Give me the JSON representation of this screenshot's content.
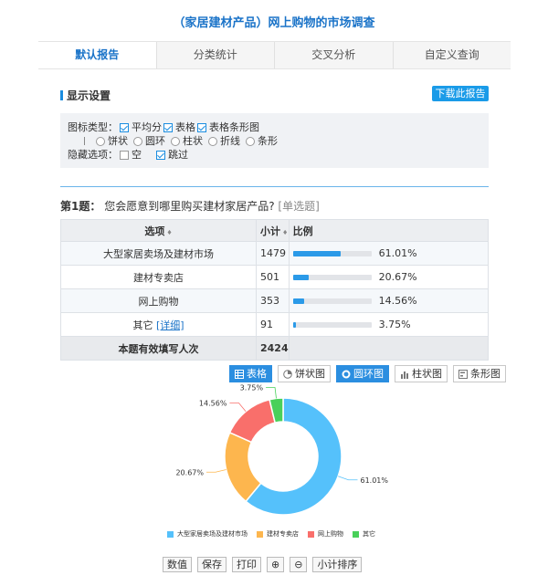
{
  "page_title": "（家居建材产品）网上购物的市场调查",
  "tabs": [
    {
      "label": "默认报告",
      "active": true
    },
    {
      "label": "分类统计",
      "active": false
    },
    {
      "label": "交叉分析",
      "active": false
    },
    {
      "label": "自定义查询",
      "active": false
    }
  ],
  "settings": {
    "title": "显示设置",
    "download_label": "下载此报告",
    "chart_type_label": "图标类型：",
    "chart_type_checks": [
      {
        "label": "平均分",
        "checked": true
      },
      {
        "label": "表格",
        "checked": true
      },
      {
        "label": "表格条形图",
        "checked": true
      }
    ],
    "chart_type_radios": [
      "饼状",
      "圆环",
      "柱状",
      "折线",
      "条形"
    ],
    "hide_label": "隐藏选项：",
    "hide_checks": [
      {
        "label": "空",
        "checked": false
      },
      {
        "label": "跳过",
        "checked": true
      }
    ]
  },
  "question": {
    "number": "第1题：",
    "text": "您会愿意到哪里购买建材家居产品?",
    "type": "[单选题]"
  },
  "table": {
    "headers": {
      "option": "选项",
      "count": "小计",
      "ratio": "比例"
    },
    "rows": [
      {
        "option": "大型家居卖场及建材市场",
        "count": "1479",
        "percent": "61.01%",
        "fraction": 0.6101,
        "link": ""
      },
      {
        "option": "建材专卖店",
        "count": "501",
        "percent": "20.67%",
        "fraction": 0.2067,
        "link": ""
      },
      {
        "option": "网上购物",
        "count": "353",
        "percent": "14.56%",
        "fraction": 0.1456,
        "link": ""
      },
      {
        "option": "其它",
        "count": "91",
        "percent": "3.75%",
        "fraction": 0.0375,
        "link": "[详细]"
      }
    ],
    "total_label": "本题有效填写人次",
    "total_count": "2424"
  },
  "chart_tabs": [
    {
      "label": "表格",
      "icon": "table-icon",
      "active": true
    },
    {
      "label": "饼状图",
      "icon": "pie-chart-icon",
      "active": false
    },
    {
      "label": "圆环图",
      "icon": "donut-chart-icon",
      "active": true
    },
    {
      "label": "柱状图",
      "icon": "bar-chart-icon",
      "active": false
    },
    {
      "label": "条形图",
      "icon": "horizontal-bar-icon",
      "active": false
    }
  ],
  "chart_data": {
    "type": "pie",
    "variant": "donut",
    "categories": [
      "大型家居卖场及建材市场",
      "建材专卖店",
      "网上购物",
      "其它"
    ],
    "values": [
      61.01,
      20.67,
      14.56,
      3.75
    ],
    "labels": [
      "61.01%",
      "20.67%",
      "14.56%",
      "3.75%"
    ],
    "colors": [
      "#55c1fb",
      "#fdb64e",
      "#f96f6b",
      "#49d05a"
    ],
    "legend_position": "bottom"
  },
  "bottom_buttons": [
    "数值",
    "保存",
    "打印",
    "⊕",
    "⊖",
    "小计排序"
  ],
  "colors": {
    "accent": "#1a73c8",
    "bar": "#2b9ae8"
  }
}
